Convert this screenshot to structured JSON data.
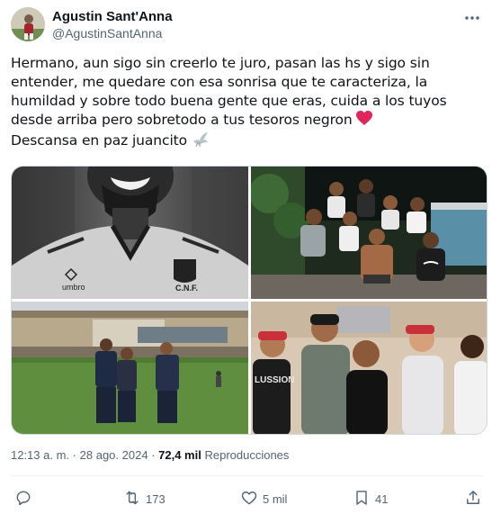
{
  "author": {
    "display_name": "Agustin Sant'Anna",
    "handle": "@AgustinSantAnna"
  },
  "tweet": {
    "text": "Hermano, aun sigo sin creerlo te juro, pasan las hs y sigo sin entender, me quedare con esa sonrisa que te caracteriza, la humildad y sobre todo buena gente que eras, cuida a los tuyos desde arriba pero sobretodo a tus tesoros negron",
    "line2": "Descansa en paz juancito",
    "heart_color": "#e0245e"
  },
  "media": {
    "images": [
      {
        "name": "photo-1-smiling-player-bw",
        "jersey_text": "C.N.F.",
        "brand_text": "umbro"
      },
      {
        "name": "photo-2-group-pool-night"
      },
      {
        "name": "photo-3-stadium-pitch"
      },
      {
        "name": "photo-4-group-indoor"
      }
    ],
    "jersey_text_2": "LUSSION"
  },
  "meta": {
    "time": "12:13 a. m.",
    "separator": "·",
    "date": "28 ago. 2024",
    "views_count": "72,4 mil",
    "views_label": "Reproducciones"
  },
  "actions": {
    "reply": "",
    "retweet": "173",
    "like": "5 mil",
    "bookmark": "41"
  },
  "colors": {
    "text": "#0f1419",
    "secondary": "#536471",
    "border": "#cfd9de"
  }
}
